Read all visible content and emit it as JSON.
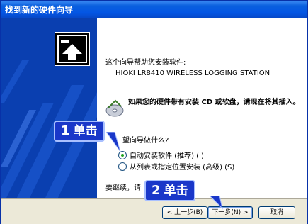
{
  "window": {
    "title": "找到新的硬件向导"
  },
  "wizard": {
    "intro": "这个向导帮助您安装软件:",
    "device_name": "HIOKI LR8410 WIRELESS LOGGING STATION",
    "cd_note": "如果您的硬件带有安装 CD 或软盘，请现在将其插入。",
    "question": "您期望向导做什么?",
    "question_visible": "望向导做什么?",
    "options": [
      {
        "label": "自动安装软件 (推荐) (I)",
        "selected": true
      },
      {
        "label": "从列表或指定位置安装 (高级) (S)",
        "selected": false
      }
    ],
    "continue_text": "要继续，请"
  },
  "buttons": {
    "back": "< 上一步(B)",
    "next": "下一步(N) >",
    "cancel": "取消"
  },
  "callouts": [
    {
      "number": "1",
      "text": "单击"
    },
    {
      "number": "2",
      "text": "单击"
    }
  ],
  "colors": {
    "callout_bg": "#1a37c9",
    "titlebar": "#0456e4",
    "banner": "#0a3fb0"
  }
}
